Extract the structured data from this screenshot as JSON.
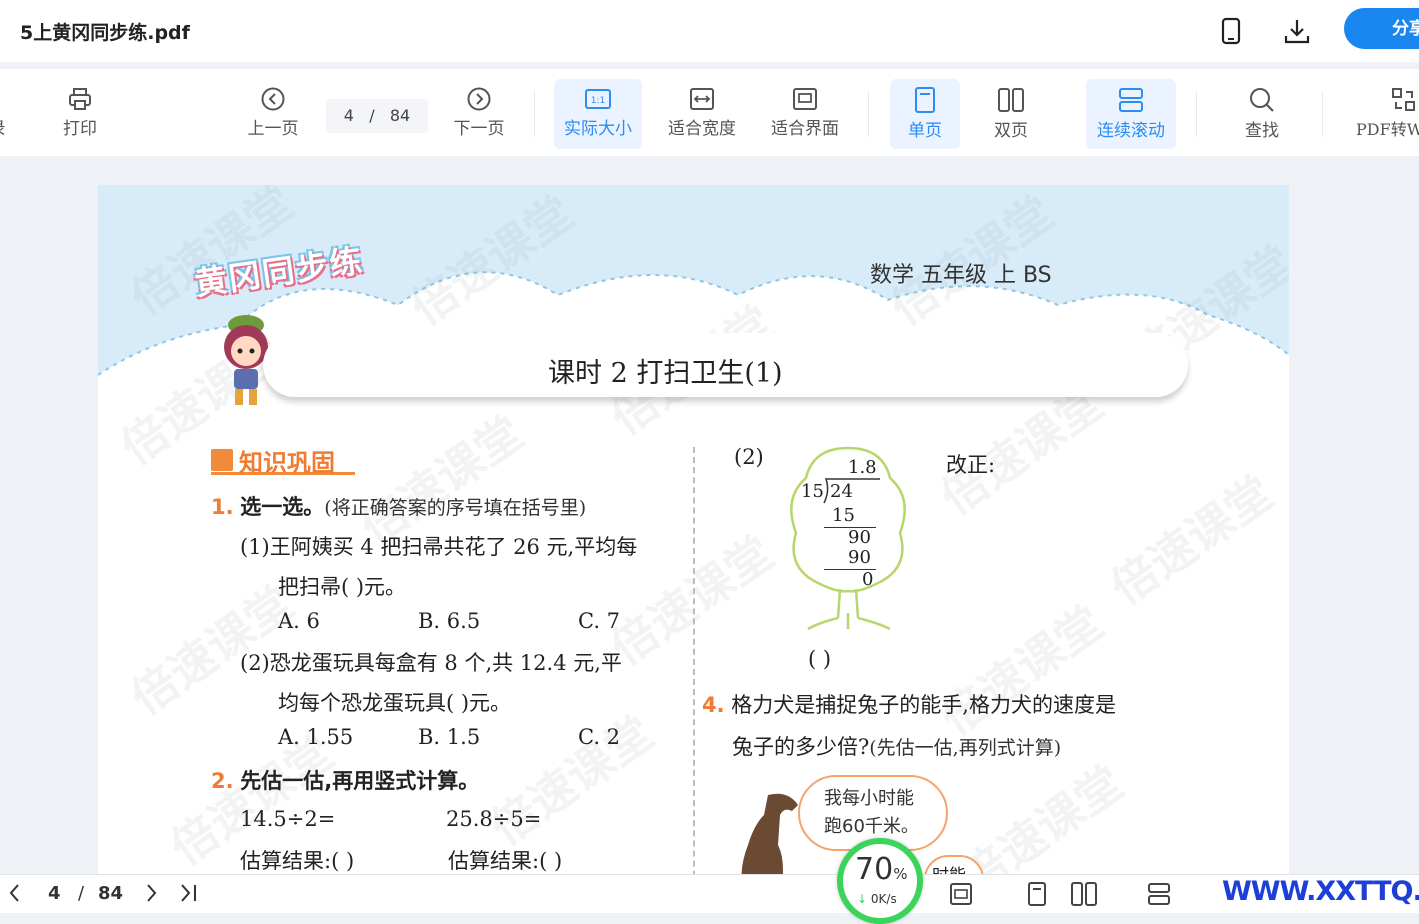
{
  "title_bar": {
    "doc_title": "5上黄冈同步练.pdf",
    "share_label": "分享",
    "icons": [
      "phone-icon",
      "download-icon"
    ]
  },
  "toolbar": {
    "items": [
      {
        "label": "录",
        "icon": "catalog-icon"
      },
      {
        "label": "打印",
        "icon": "print-icon"
      },
      {
        "label": "上一页",
        "icon": "prev-page-icon"
      },
      {
        "label": "下一页",
        "icon": "next-page-icon"
      },
      {
        "label": "实际大小",
        "icon": "actual-size-icon",
        "active": true
      },
      {
        "label": "适合宽度",
        "icon": "fit-width-icon"
      },
      {
        "label": "适合界面",
        "icon": "fit-page-icon"
      },
      {
        "label": "单页",
        "icon": "single-page-icon",
        "active": true
      },
      {
        "label": "双页",
        "icon": "double-page-icon"
      },
      {
        "label": "连续滚动",
        "icon": "continuous-scroll-icon",
        "active": true
      },
      {
        "label": "查找",
        "icon": "search-icon"
      },
      {
        "label": "PDF转W",
        "icon": "pdf-convert-icon"
      }
    ],
    "page_current": "4",
    "page_sep": "/",
    "page_total": "84"
  },
  "document": {
    "watermark": "倍速课堂",
    "logo_text": "黄冈同步练",
    "subject": "数学 五年级 上 BS",
    "lesson_title": "课时 2    打扫卫生(1)",
    "section_title": "知识巩固",
    "q1": {
      "num": "1.",
      "title": "选一选。",
      "hint": "(将正确答案的序号填在括号里)",
      "sub1_line1": "(1)王阿姨买 4 把扫帚共花了 26 元,平均每",
      "sub1_line2": "把扫帚(        )元。",
      "sub1_opts": [
        "A. 6",
        "B. 6.5",
        "C. 7"
      ],
      "sub2_line1": "(2)恐龙蛋玩具每盒有 8 个,共 12.4 元,平",
      "sub2_line2": "均每个恐龙蛋玩具(        )元。",
      "sub2_opts": [
        "A. 1.55",
        "B. 1.5",
        "C. 2"
      ]
    },
    "q2": {
      "num": "2.",
      "title": "先估一估,再用竖式计算。",
      "expr1": "14.5÷2=",
      "expr2": "25.8÷5=",
      "estimate1": "估算结果:(        )",
      "estimate2": "估算结果:(        )"
    },
    "q3": {
      "label": "(2)",
      "correction": "改正:",
      "quotient": "1.8",
      "divisor": "15",
      "dividend": "24",
      "step1": "15",
      "step2": "90",
      "step3": "90",
      "remainder": "0",
      "answer_paren": "(        )"
    },
    "q4": {
      "num": "4.",
      "line1": "格力犬是捕捉兔子的能手,格力犬的速度是",
      "line2": "兔子的多少倍?",
      "hint": "(先估一估,再列式计算)",
      "dog_says_1": "我每小时能",
      "dog_says_2": "跑60千米。",
      "rabbit_says": "时能"
    }
  },
  "status_bar": {
    "page_current": "4",
    "page_sep": "/",
    "page_total": "84",
    "speed_pct": "70",
    "speed_unit": "%",
    "speed_rate": "0K/s",
    "site": "WWW.XXTTQ.COM"
  },
  "colors": {
    "accent": "#2d8cf0",
    "share": "#1a86f0",
    "section_orange": "#f07b32",
    "sky": "#d7ecf8",
    "speed_ring": "#3cd35a"
  }
}
